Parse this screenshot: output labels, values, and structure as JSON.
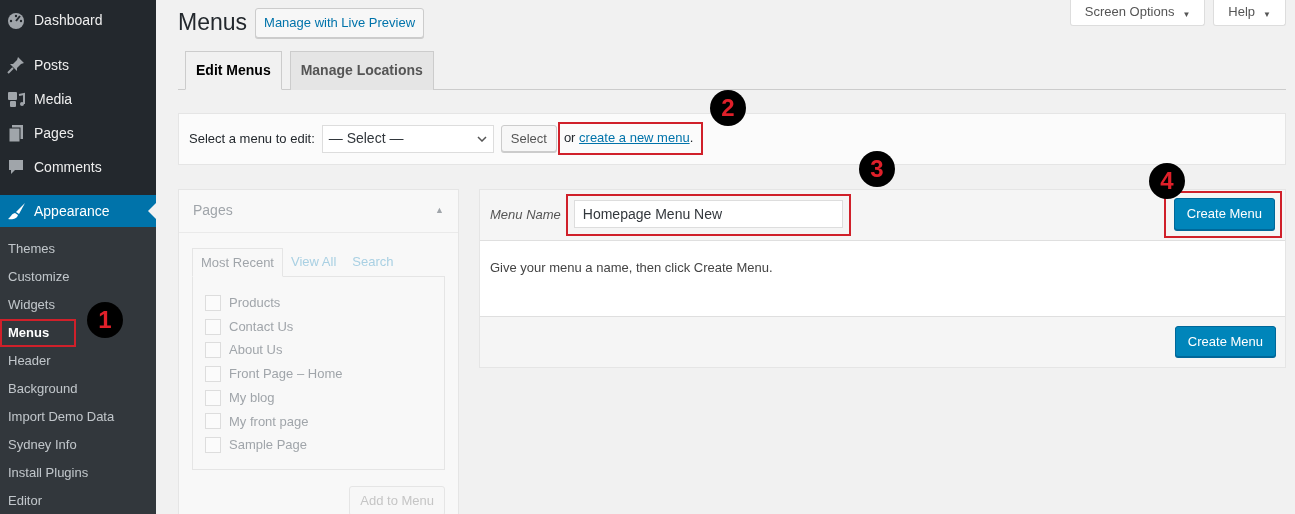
{
  "header_buttons": [
    {
      "label": "Screen Options",
      "glyph": "▼"
    },
    {
      "label": "Help",
      "glyph": "▼"
    }
  ],
  "sidebar": {
    "items": [
      {
        "label": "Dashboard",
        "kind": "gauge",
        "selected": false
      },
      {
        "label": "Posts",
        "kind": "pin",
        "selected": false
      },
      {
        "label": "Media",
        "kind": "media",
        "selected": false
      },
      {
        "label": "Pages",
        "kind": "pages",
        "selected": false
      },
      {
        "label": "Comments",
        "kind": "comment",
        "selected": false
      },
      {
        "label": "Appearance",
        "kind": "brush",
        "selected": true,
        "children": [
          {
            "label": "Themes",
            "selected": false,
            "highlighted": false
          },
          {
            "label": "Customize",
            "selected": false,
            "highlighted": false
          },
          {
            "label": "Widgets",
            "selected": false,
            "highlighted": false
          },
          {
            "label": "Menus",
            "selected": true,
            "highlighted": true
          },
          {
            "label": "Header",
            "selected": false,
            "highlighted": false
          },
          {
            "label": "Background",
            "selected": false,
            "highlighted": false
          },
          {
            "label": "Import Demo Data",
            "selected": false,
            "highlighted": false
          },
          {
            "label": "Sydney Info",
            "selected": false,
            "highlighted": false
          },
          {
            "label": "Install Plugins",
            "selected": false,
            "highlighted": false
          },
          {
            "label": "Editor",
            "selected": false,
            "highlighted": false
          }
        ]
      }
    ]
  },
  "title": "Menus",
  "title_button": "Manage with Live Preview",
  "tabs": [
    {
      "label": "Edit Menus",
      "selected": true
    },
    {
      "label": "Manage Locations",
      "selected": false
    }
  ],
  "select_bar": {
    "label": "Select a menu to edit:",
    "select_value": "— Select —",
    "button": "Select",
    "or_text": "or",
    "link": "create a new menu",
    "link_suffix": ".",
    "highlighted": true
  },
  "pages_panel": {
    "title": "Pages",
    "collapse_glyph": "▲",
    "tabs": [
      {
        "label": "Most Recent",
        "selected": true
      },
      {
        "label": "View All",
        "selected": false
      },
      {
        "label": "Search",
        "selected": false
      }
    ],
    "items": [
      {
        "label": "Products",
        "checked": false
      },
      {
        "label": "Contact Us",
        "checked": false
      },
      {
        "label": "About Us",
        "checked": false
      },
      {
        "label": "Front Page – Home",
        "checked": false
      },
      {
        "label": "My blog",
        "checked": false
      },
      {
        "label": "My front page",
        "checked": false
      },
      {
        "label": "Sample Page",
        "checked": false
      }
    ],
    "button": "Add to Menu",
    "disabled": true
  },
  "menu_editor": {
    "name_label": "Menu Name",
    "name_value": "Homepage Menu New",
    "name_highlighted": true,
    "top_button": "Create Menu",
    "top_button_highlighted": true,
    "hint": "Give your menu a name, then click Create Menu.",
    "bottom_button": "Create Menu"
  },
  "callouts": [
    {
      "label": "1"
    },
    {
      "label": "2"
    },
    {
      "label": "3"
    },
    {
      "label": "4"
    }
  ]
}
